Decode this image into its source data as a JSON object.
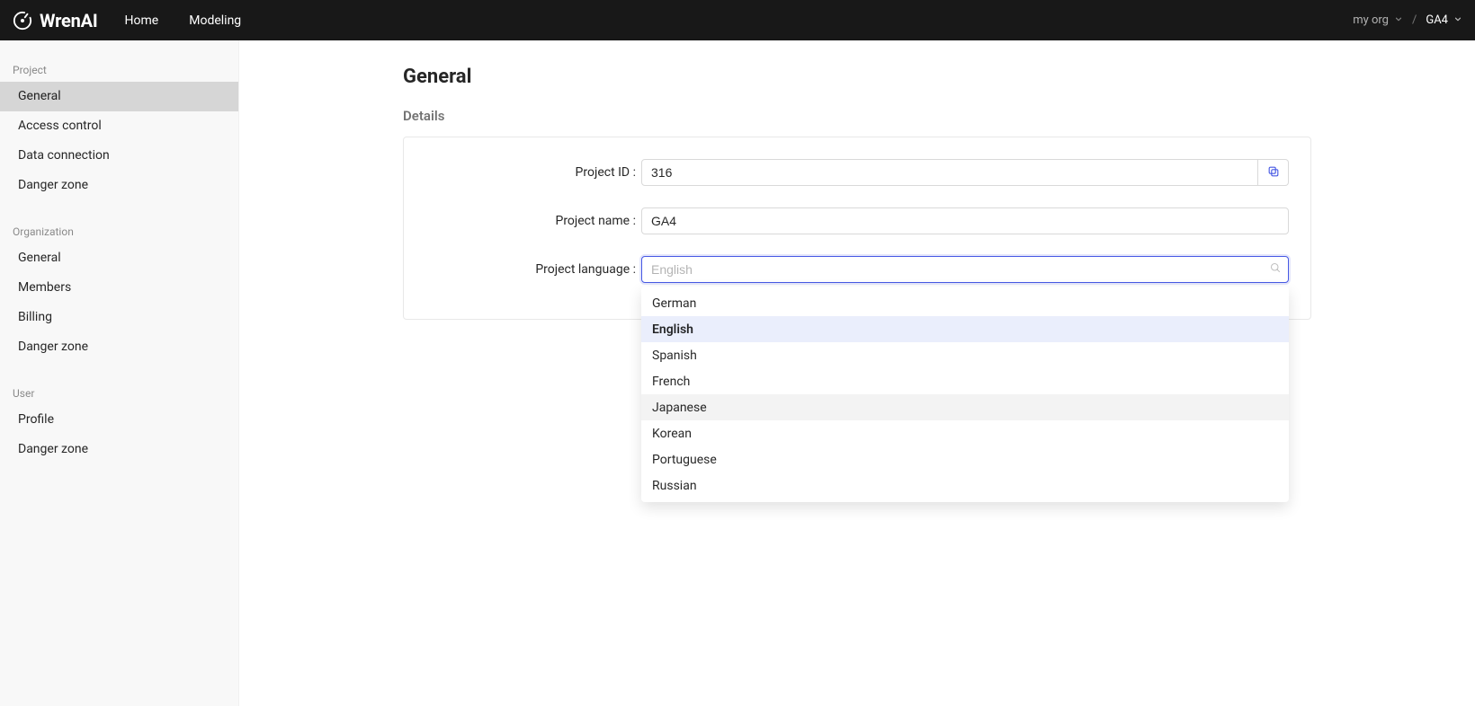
{
  "brand": {
    "name": "WrenAI"
  },
  "nav": {
    "home": "Home",
    "modeling": "Modeling"
  },
  "crumbs": {
    "org": "my org",
    "project": "GA4"
  },
  "sidebar": {
    "groups": [
      {
        "label": "Project",
        "items": [
          {
            "label": "General",
            "active": true
          },
          {
            "label": "Access control"
          },
          {
            "label": "Data connection"
          },
          {
            "label": "Danger zone"
          }
        ]
      },
      {
        "label": "Organization",
        "items": [
          {
            "label": "General"
          },
          {
            "label": "Members"
          },
          {
            "label": "Billing"
          },
          {
            "label": "Danger zone"
          }
        ]
      },
      {
        "label": "User",
        "items": [
          {
            "label": "Profile"
          },
          {
            "label": "Danger zone"
          }
        ]
      }
    ]
  },
  "page": {
    "title": "General",
    "section_details": "Details"
  },
  "form": {
    "project_id_label": "Project ID",
    "project_id_value": "316",
    "project_name_label": "Project name",
    "project_name_value": "GA4",
    "project_language_label": "Project language",
    "project_language_placeholder": "English",
    "language_options": [
      {
        "label": "German"
      },
      {
        "label": "English",
        "selected": true
      },
      {
        "label": "Spanish"
      },
      {
        "label": "French"
      },
      {
        "label": "Japanese",
        "hover": true
      },
      {
        "label": "Korean"
      },
      {
        "label": "Portuguese"
      },
      {
        "label": "Russian"
      }
    ]
  }
}
